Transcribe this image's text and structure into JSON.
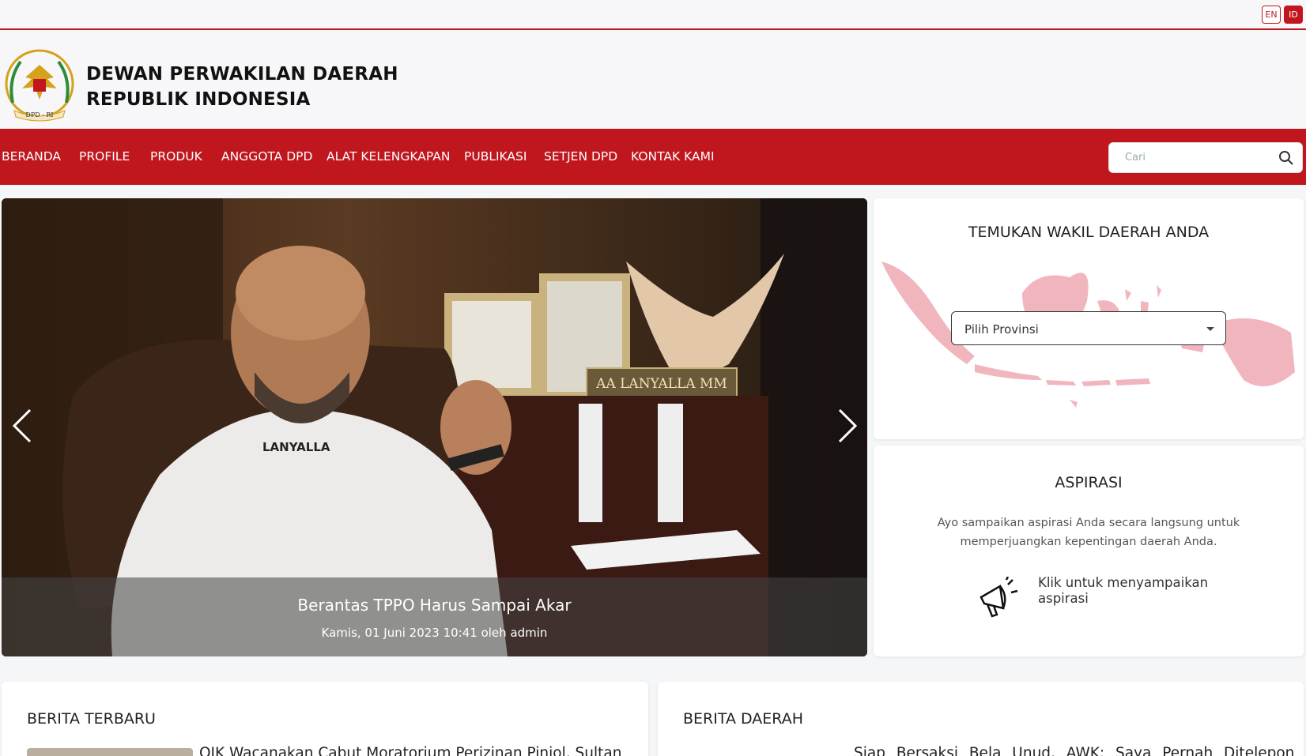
{
  "lang": {
    "en": "EN",
    "id": "ID"
  },
  "brand": {
    "line1": "DEWAN PERWAKILAN DAERAH",
    "line2": "REPUBLIK INDONESIA",
    "logo_text": "DPD - RI"
  },
  "nav": {
    "items": [
      {
        "label": "BERANDA"
      },
      {
        "label": "PROFILE"
      },
      {
        "label": "PRODUK"
      },
      {
        "label": "ANGGOTA DPD"
      },
      {
        "label": "ALAT KELENGKAPAN"
      },
      {
        "label": "PUBLIKASI"
      },
      {
        "label": "SETJEN DPD"
      },
      {
        "label": "KONTAK KAMI"
      }
    ],
    "search_placeholder": "Cari"
  },
  "hero": {
    "title": "Berantas TPPO Harus Sampai Akar",
    "meta": "Kamis, 01 Juni 2023 10:41 oleh admin",
    "nameplate": "AA LANYALLA MM",
    "shirt_text": "LANYALLA"
  },
  "map_card": {
    "title": "TEMUKAN WAKIL DAERAH ANDA",
    "select_value": "Pilih Provinsi"
  },
  "aspirasi": {
    "title": "ASPIRASI",
    "description": "Ayo sampaikan aspirasi Anda secara langsung untuk memperjuangkan kepentingan daerah Anda.",
    "link": "Klik untuk menyampaikan aspirasi"
  },
  "news": {
    "title": "BERITA TERBARU",
    "headline": "OJK Wacanakan Cabut Moratorium Perizinan Pinjol, Sultan"
  },
  "regional": {
    "title": "BERITA DAERAH",
    "headline": "Siap Bersaksi Bela Unud, AWK: Saya Pernah Ditelepon"
  },
  "colors": {
    "brand_red": "#c0171f",
    "map_pink": "#f1b6bd"
  }
}
